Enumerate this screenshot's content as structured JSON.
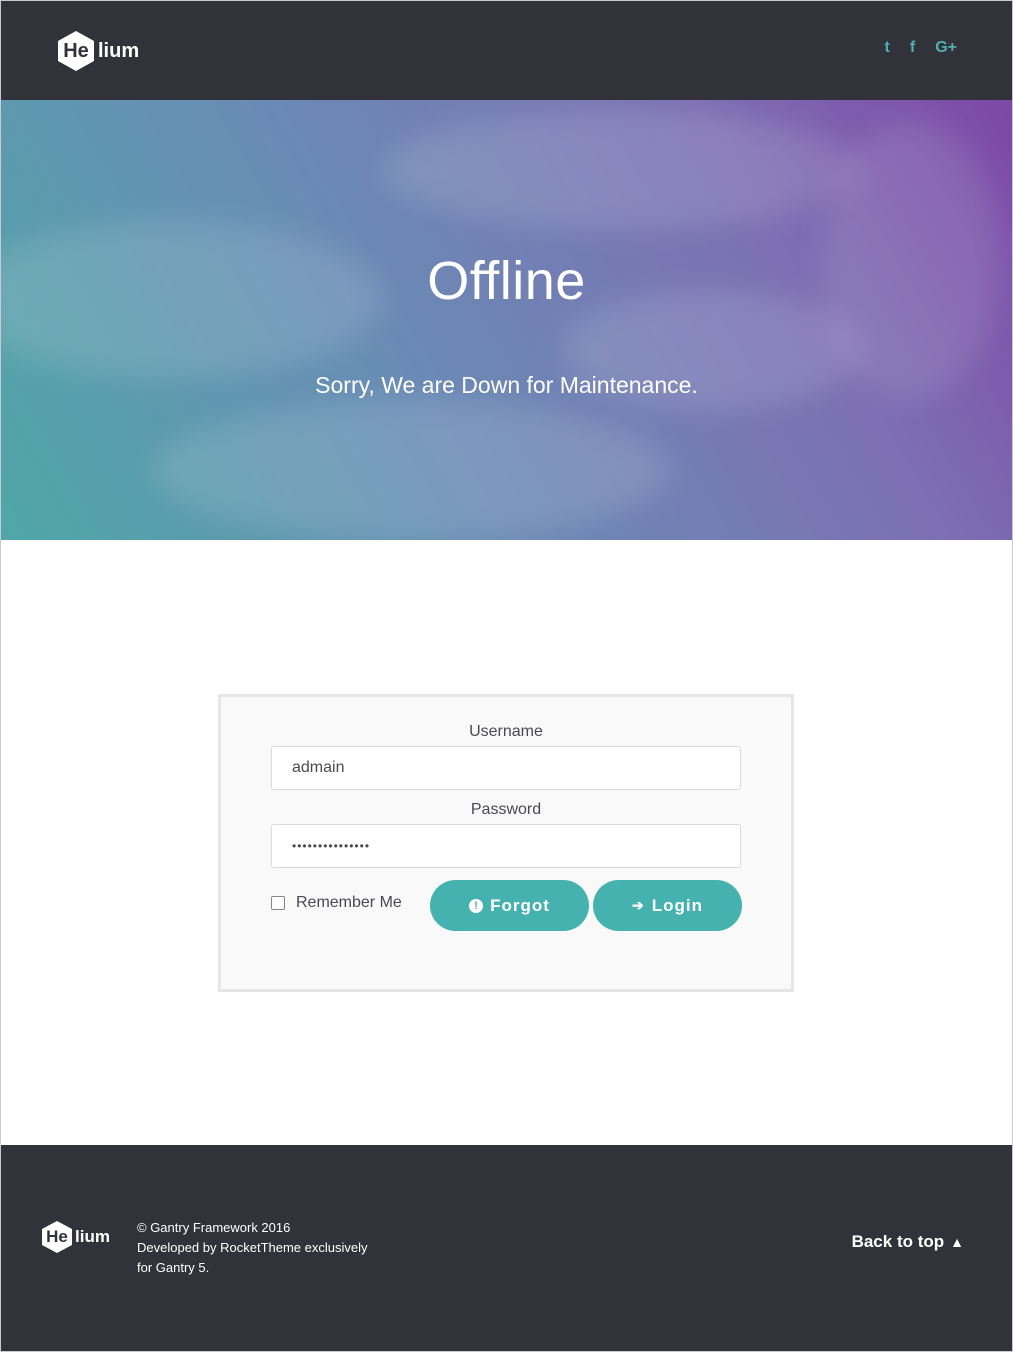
{
  "header": {
    "logo_mark": "He",
    "logo_rest": "lium",
    "social": [
      {
        "icon": "twitter-icon",
        "glyph": "t"
      },
      {
        "icon": "facebook-icon",
        "glyph": "f"
      },
      {
        "icon": "google-plus-icon",
        "glyph": "G+"
      }
    ]
  },
  "hero": {
    "title": "Offline",
    "subtitle": "Sorry, We are Down for Maintenance."
  },
  "login": {
    "username_label": "Username",
    "username_value": "admain",
    "password_label": "Password",
    "password_value": "•••••••••••••••",
    "remember_label": "Remember Me",
    "forgot_label": "Forgot",
    "login_label": "Login"
  },
  "footer": {
    "logo_mark": "He",
    "logo_rest": "lium",
    "copyright_lines": [
      "© Gantry Framework 2016",
      "Developed by RocketTheme exclusively",
      "for Gantry 5."
    ],
    "back_to_top": "Back to top"
  },
  "colors": {
    "header_bg": "#32323b",
    "accent": "#45b2b0",
    "hero_gradient": [
      "#4fa7a8",
      "#7d47a6"
    ]
  }
}
